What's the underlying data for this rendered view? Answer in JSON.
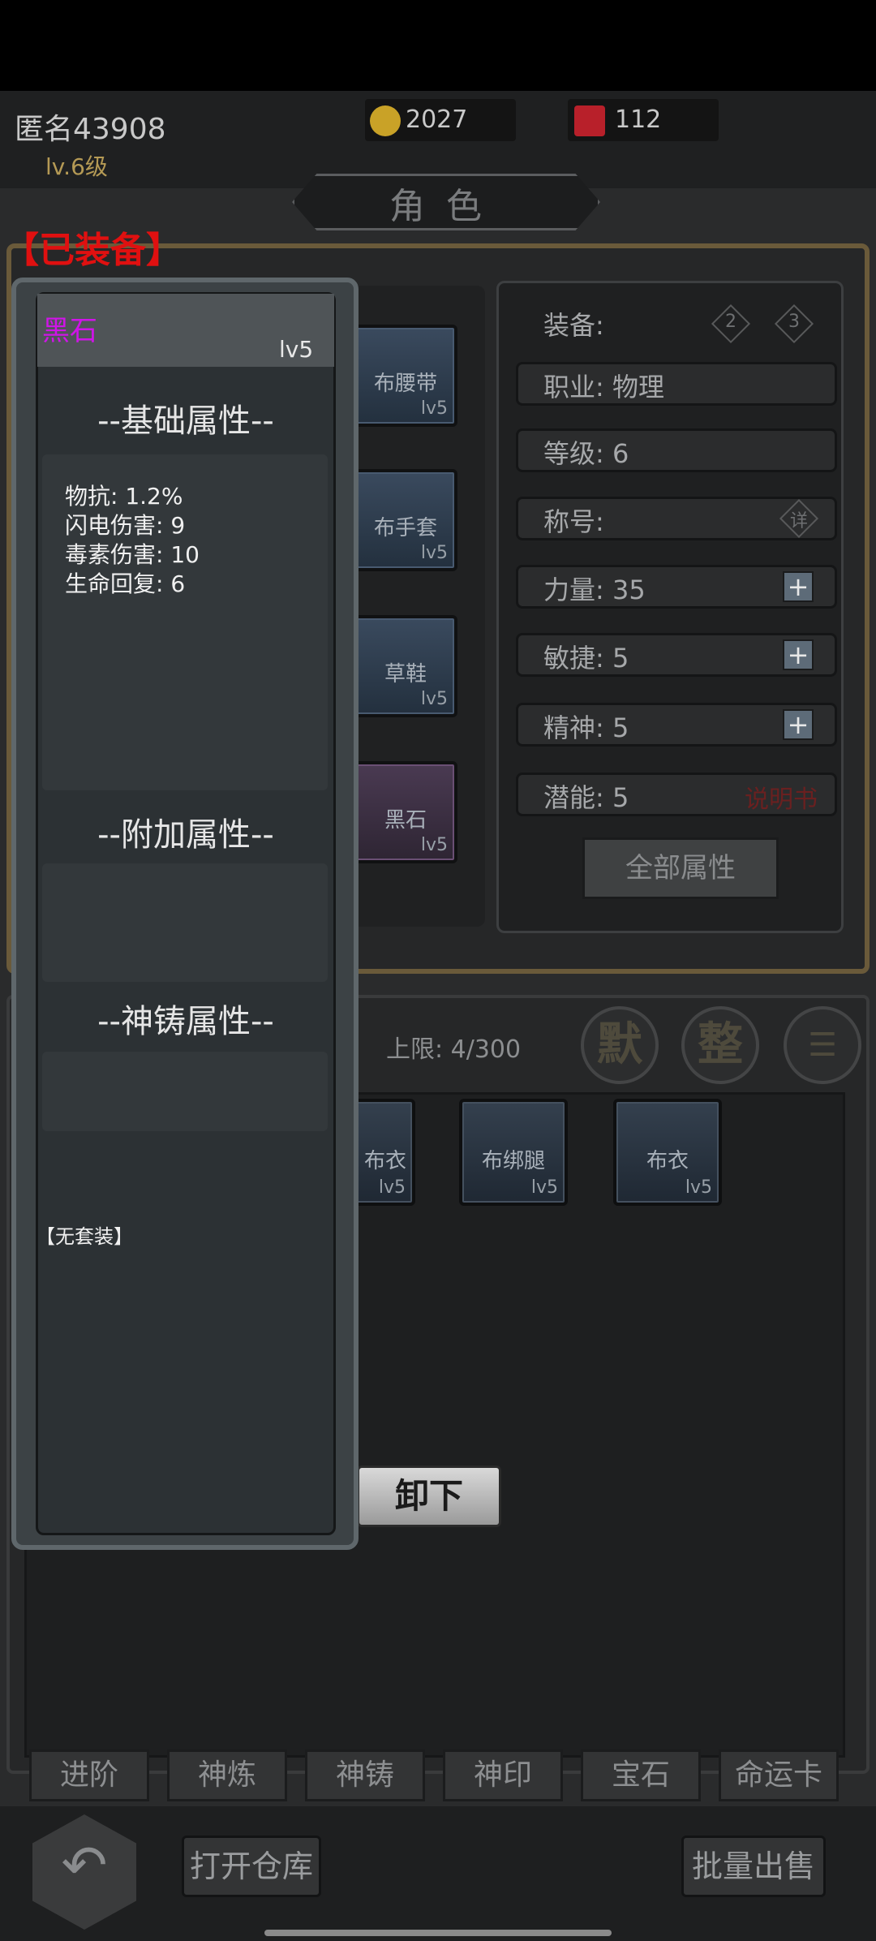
{
  "player": {
    "name": "匿名43908",
    "level": "lv.6级"
  },
  "resources": [
    {
      "icon": "gold-coin-icon",
      "value": "2027",
      "color": "#c9a227"
    },
    {
      "icon": "red-gem-icon",
      "value": "112",
      "color": "#b8202a"
    }
  ],
  "page_title": "角色",
  "equipped_label": "【已装备】",
  "equipment_slots": [
    {
      "name": "布腰带",
      "level": "lv5"
    },
    {
      "name": "布手套",
      "level": "lv5"
    },
    {
      "name": "草鞋",
      "level": "lv5"
    },
    {
      "name": "黑石",
      "level": "lv5"
    }
  ],
  "stats": {
    "equip_label": "装备:",
    "presets": [
      "2",
      "3"
    ],
    "class": "职业: 物理",
    "level": "等级: 6",
    "title": "称号:",
    "title_detail": "详",
    "strength": "力量: 35",
    "agility": "敏捷: 5",
    "spirit": "精神: 5",
    "potential": "潜能: 5",
    "manual_link": "说明书",
    "plus": "+",
    "all_attributes_button": "全部属性"
  },
  "inventory": {
    "capacity": "上限: 4/300",
    "default_sort": "默",
    "organize": "整",
    "menu_icon": "list-menu-icon",
    "items": [
      {
        "name": "布衣",
        "level": "lv5",
        "partial": "布衣"
      },
      {
        "name": "布绑腿",
        "level": "lv5"
      },
      {
        "name": "布衣",
        "level": "lv5"
      }
    ]
  },
  "tooltip": {
    "item_name": "黑石",
    "item_level": "lv5",
    "name_color": "#d014e8",
    "base_title": "--基础属性--",
    "base_attributes": [
      "物抗: 1.2%",
      "闪电伤害: 9",
      "毒素伤害: 10",
      "生命回复: 6"
    ],
    "extra_title": "--附加属性--",
    "divine_title": "--神铸属性--",
    "set_info": "【无套装】"
  },
  "unequip_button": "卸下",
  "tabs": [
    "进阶",
    "神炼",
    "神铸",
    "神印",
    "宝石",
    "命运卡"
  ],
  "bottom": {
    "back_icon": "back-arrow-icon",
    "open_warehouse": "打开仓库",
    "bulk_sell": "批量出售"
  }
}
